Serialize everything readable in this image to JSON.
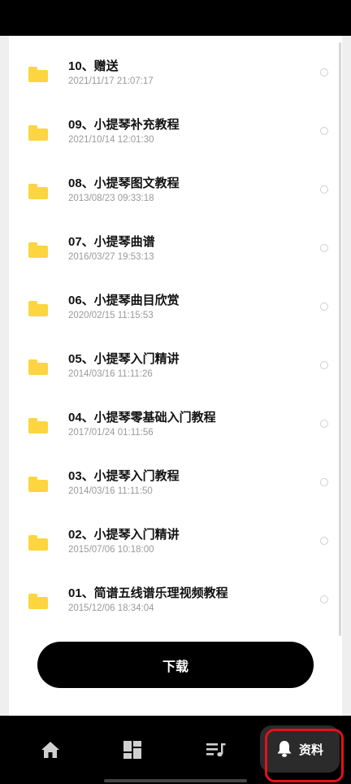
{
  "files": [
    {
      "title": "10、赠送",
      "date": "2021/11/17 21:07:17"
    },
    {
      "title": "09、小提琴补充教程",
      "date": "2021/10/14 12:01:30"
    },
    {
      "title": "08、小提琴图文教程",
      "date": "2013/08/23 09:33:18"
    },
    {
      "title": "07、小提琴曲谱",
      "date": "2016/03/27 19:53:13"
    },
    {
      "title": "06、小提琴曲目欣赏",
      "date": "2020/02/15 11:15:53"
    },
    {
      "title": "05、小提琴入门精讲",
      "date": "2014/03/16 11:11:26"
    },
    {
      "title": "04、小提琴零基础入门教程",
      "date": "2017/01/24 01:11:56"
    },
    {
      "title": "03、小提琴入门教程",
      "date": "2014/03/16 11:11:50"
    },
    {
      "title": "02、小提琴入门精讲",
      "date": "2015/07/06 10:18:00"
    },
    {
      "title": "01、简谱五线谱乐理视频教程",
      "date": "2015/12/06 18:34:04"
    }
  ],
  "download_label": "下载",
  "tabbar": {
    "items": [
      {
        "icon": "home-icon"
      },
      {
        "icon": "dashboard-icon"
      },
      {
        "icon": "playlist-icon"
      },
      {
        "icon": "bell-icon",
        "label": "资料",
        "active": true
      }
    ]
  },
  "colors": {
    "folder": "#fcd53f",
    "highlight": "#e3121b"
  }
}
